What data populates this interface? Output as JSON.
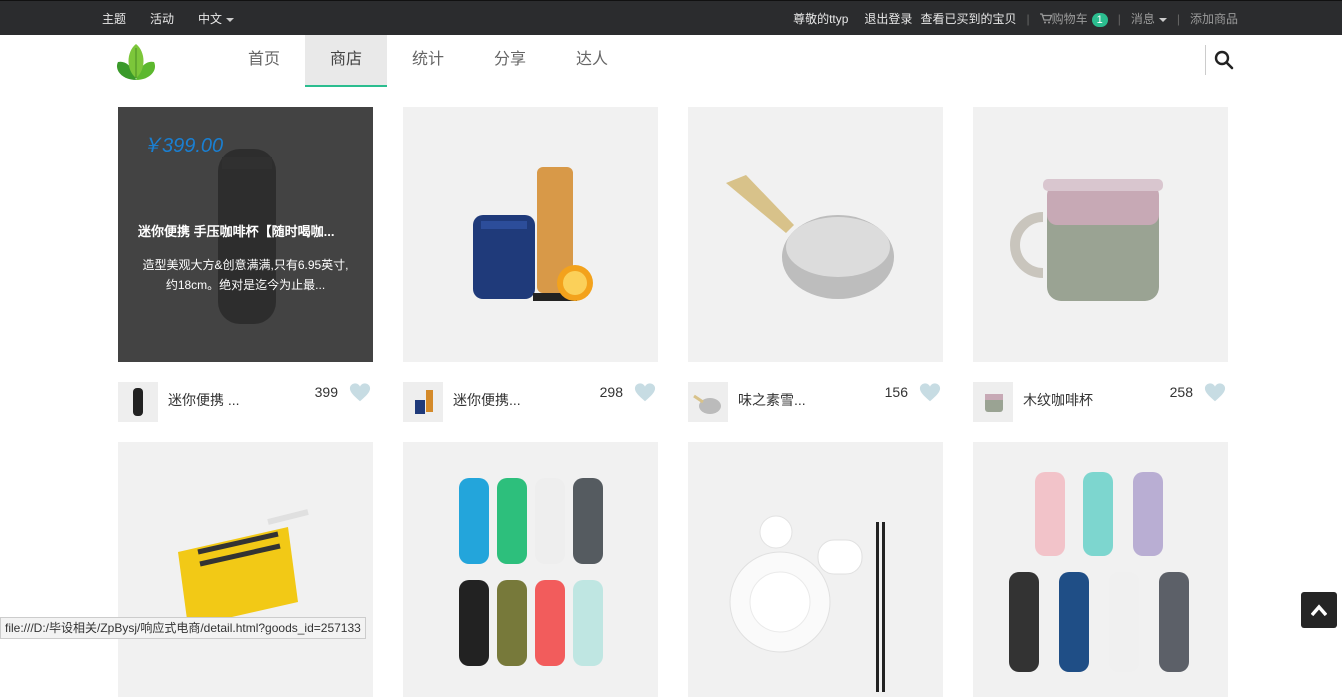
{
  "topbar": {
    "left": [
      "主题",
      "活动",
      "中文"
    ],
    "greeting": "尊敬的ttyp",
    "logout": "退出登录",
    "bought": "查看已买到的宝贝",
    "cart": "购物车",
    "cart_count": "1",
    "messages": "消息",
    "add_goods": "添加商品"
  },
  "nav": {
    "tabs": [
      "首页",
      "商店",
      "统计",
      "分享",
      "达人"
    ],
    "active_tab": "商店"
  },
  "products": [
    {
      "name": "迷你便携 ...",
      "count": "399",
      "price": "￥399.00",
      "overlay_title": "迷你便携 手压咖啡杯【随时喝咖...",
      "overlay_desc": "造型美观大方&创意满满,只有6.95英寸,约18cm。绝对是迄今为止最..."
    },
    {
      "name": "迷你便携...",
      "count": "298"
    },
    {
      "name": "味之素雪...",
      "count": "156"
    },
    {
      "name": "木纹咖啡杯",
      "count": "258"
    }
  ],
  "status_url": "file:///D:/毕设相关/ZpBysj/响应式电商/detail.html?goods_id=257133",
  "colors": {
    "accent": "#2bbd8f",
    "topbar": "#2b2c2e",
    "price": "#1a7fd1"
  }
}
